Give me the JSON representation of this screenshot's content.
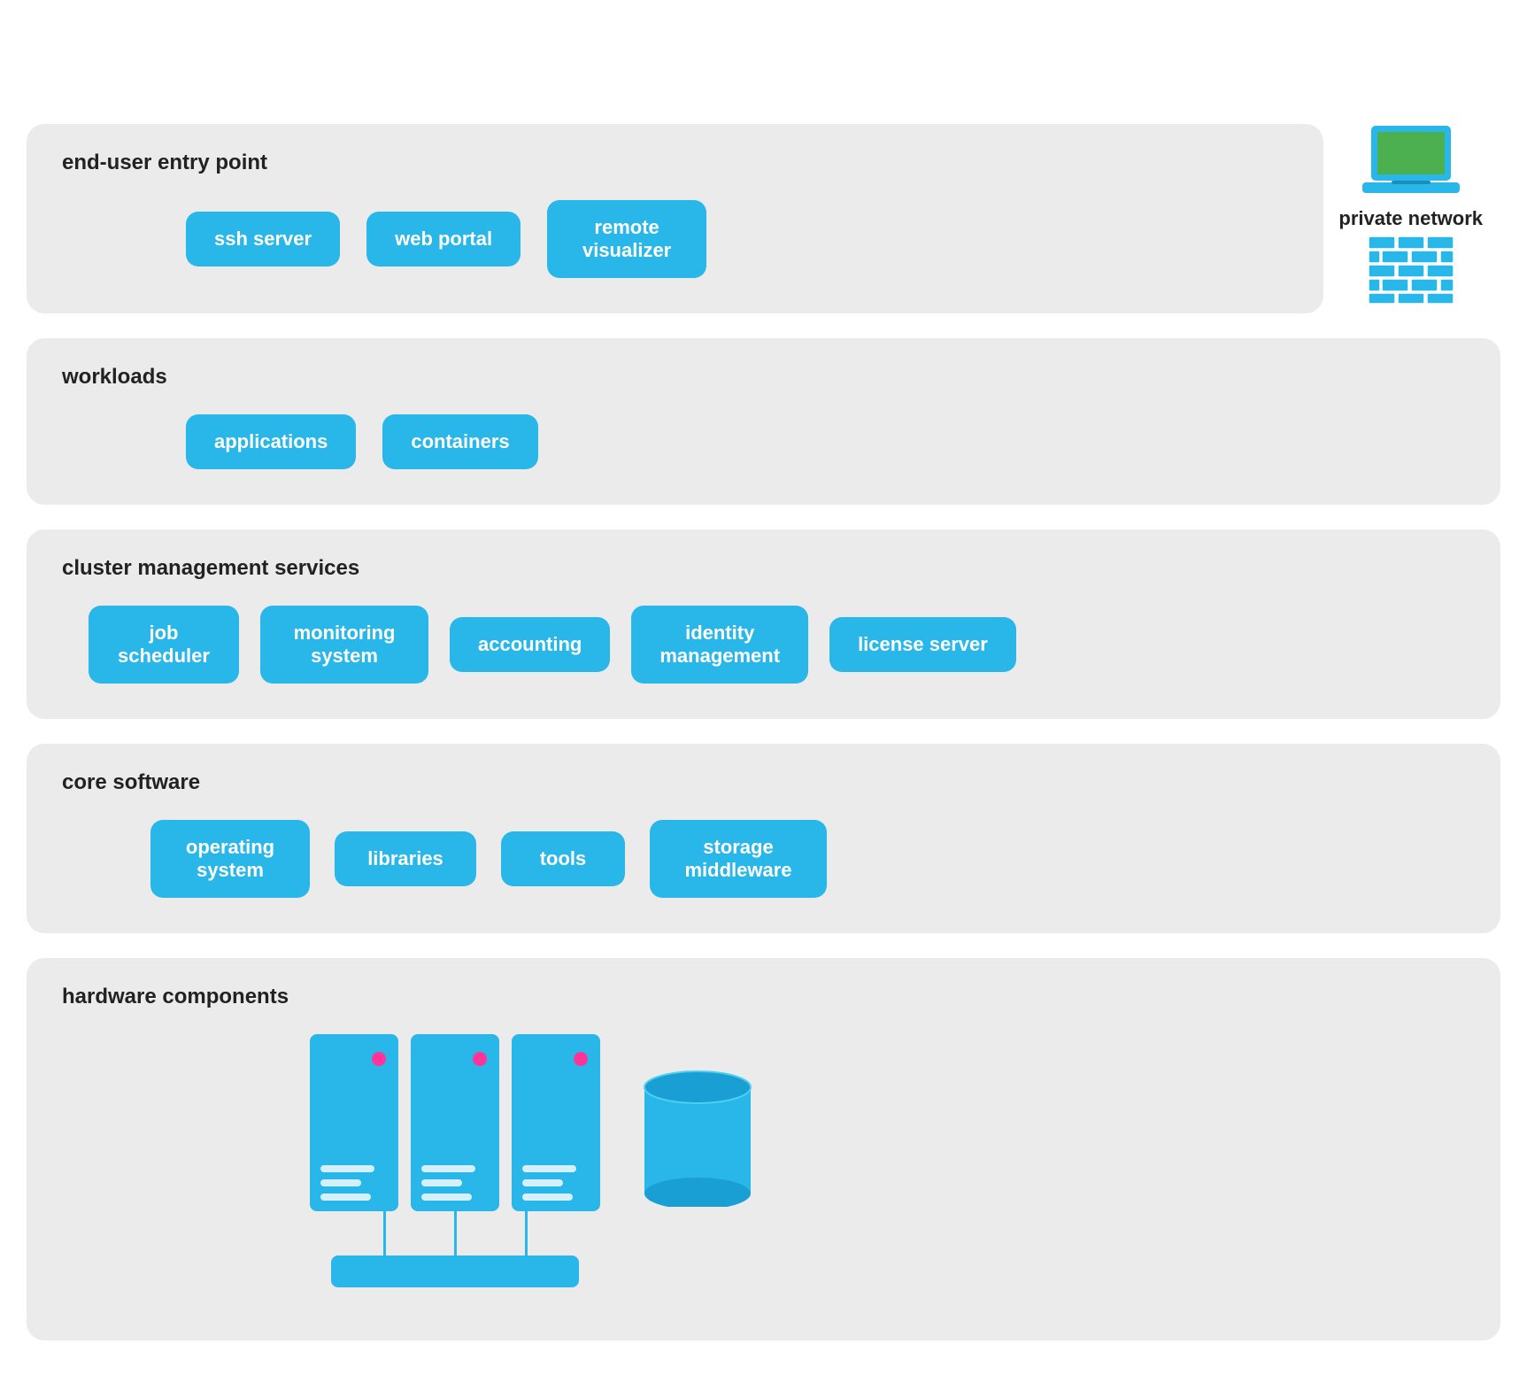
{
  "private_network": {
    "label": "private network"
  },
  "sections": [
    {
      "id": "end-user-entry-point",
      "label": "end-user entry point",
      "chips": [
        {
          "id": "ssh-server",
          "text": "ssh server"
        },
        {
          "id": "web-portal",
          "text": "web portal"
        },
        {
          "id": "remote-visualizer",
          "text": "remote\nvisualizer"
        }
      ]
    },
    {
      "id": "workloads",
      "label": "workloads",
      "chips": [
        {
          "id": "applications",
          "text": "applications"
        },
        {
          "id": "containers",
          "text": "containers"
        }
      ]
    },
    {
      "id": "cluster-management-services",
      "label": "cluster management services",
      "chips": [
        {
          "id": "job-scheduler",
          "text": "job\nscheduler"
        },
        {
          "id": "monitoring-system",
          "text": "monitoring\nsystem"
        },
        {
          "id": "accounting",
          "text": "accounting"
        },
        {
          "id": "identity-management",
          "text": "identity\nmanagement"
        },
        {
          "id": "license-server",
          "text": "license server"
        }
      ]
    },
    {
      "id": "core-software",
      "label": "core software",
      "chips": [
        {
          "id": "operating-system",
          "text": "operating\nsystem"
        },
        {
          "id": "libraries",
          "text": "libraries"
        },
        {
          "id": "tools",
          "text": "tools"
        },
        {
          "id": "storage-middleware",
          "text": "storage\nmiddleware"
        }
      ]
    }
  ],
  "hardware": {
    "label": "hardware components"
  }
}
